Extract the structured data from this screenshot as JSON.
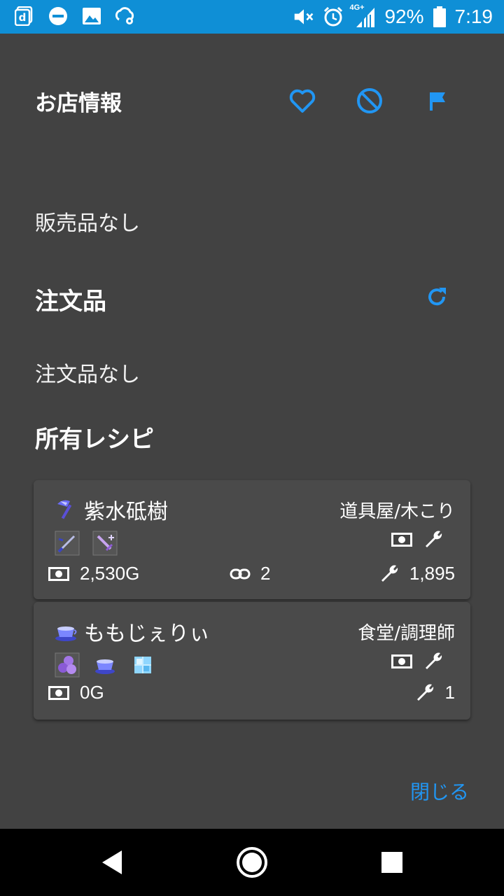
{
  "status_bar": {
    "battery_pct": "92%",
    "time": "7:19",
    "network": "4G+",
    "icons": [
      "docomo-d-icon",
      "do-not-disturb-icon",
      "image-icon",
      "cloud-settings-icon",
      "mute-icon",
      "alarm-icon",
      "signal-icon",
      "battery-icon"
    ]
  },
  "header": {
    "title": "お店情報"
  },
  "sales": {
    "empty_text": "販売品なし"
  },
  "orders": {
    "title": "注文品",
    "empty_text": "注文品なし"
  },
  "recipes": {
    "title": "所有レシピ",
    "items": [
      {
        "name": "紫水砥樹",
        "job": "道具屋/木こり",
        "icon": "axe-icon",
        "materials": [
          "katana-icon",
          "sword-icon"
        ],
        "price": "2,530G",
        "links": "2",
        "tool_count": "1,895"
      },
      {
        "name": "ももじぇりぃ",
        "job": "食堂/調理師",
        "icon": "teacup-icon",
        "materials": [
          "peach-jelly-icon",
          "teacup-icon",
          "ice-cube-icon"
        ],
        "price": "0G",
        "tool_count": "1"
      }
    ]
  },
  "footer": {
    "close_label": "閉じる"
  },
  "colors": {
    "accent": "#2196f3",
    "status_bar": "#0f8fd6",
    "background": "#424242",
    "card": "#4a4a4a"
  }
}
